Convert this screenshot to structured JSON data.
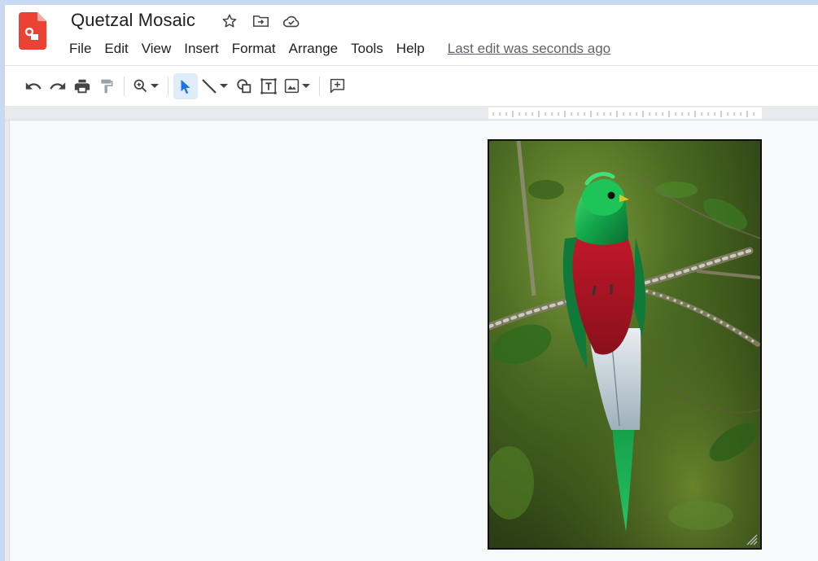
{
  "document": {
    "title": "Quetzal Mosaic",
    "last_edit": "Last edit was seconds ago"
  },
  "header_icons": [
    "star-icon",
    "move-to-folder-icon",
    "cloud-saved-icon"
  ],
  "menu": {
    "items": [
      "File",
      "Edit",
      "View",
      "Insert",
      "Format",
      "Arrange",
      "Tools",
      "Help"
    ]
  },
  "toolbar": {
    "buttons": [
      "undo-icon",
      "redo-icon",
      "print-icon",
      "paint-format-icon",
      "zoom-icon",
      "select-icon",
      "line-icon",
      "shape-icon",
      "text-box-icon",
      "image-icon",
      "comment-icon"
    ]
  },
  "colors": {
    "accent": "#1a73e8",
    "app_logo": "#ea4335",
    "window_frame": "#c9d9f3"
  }
}
